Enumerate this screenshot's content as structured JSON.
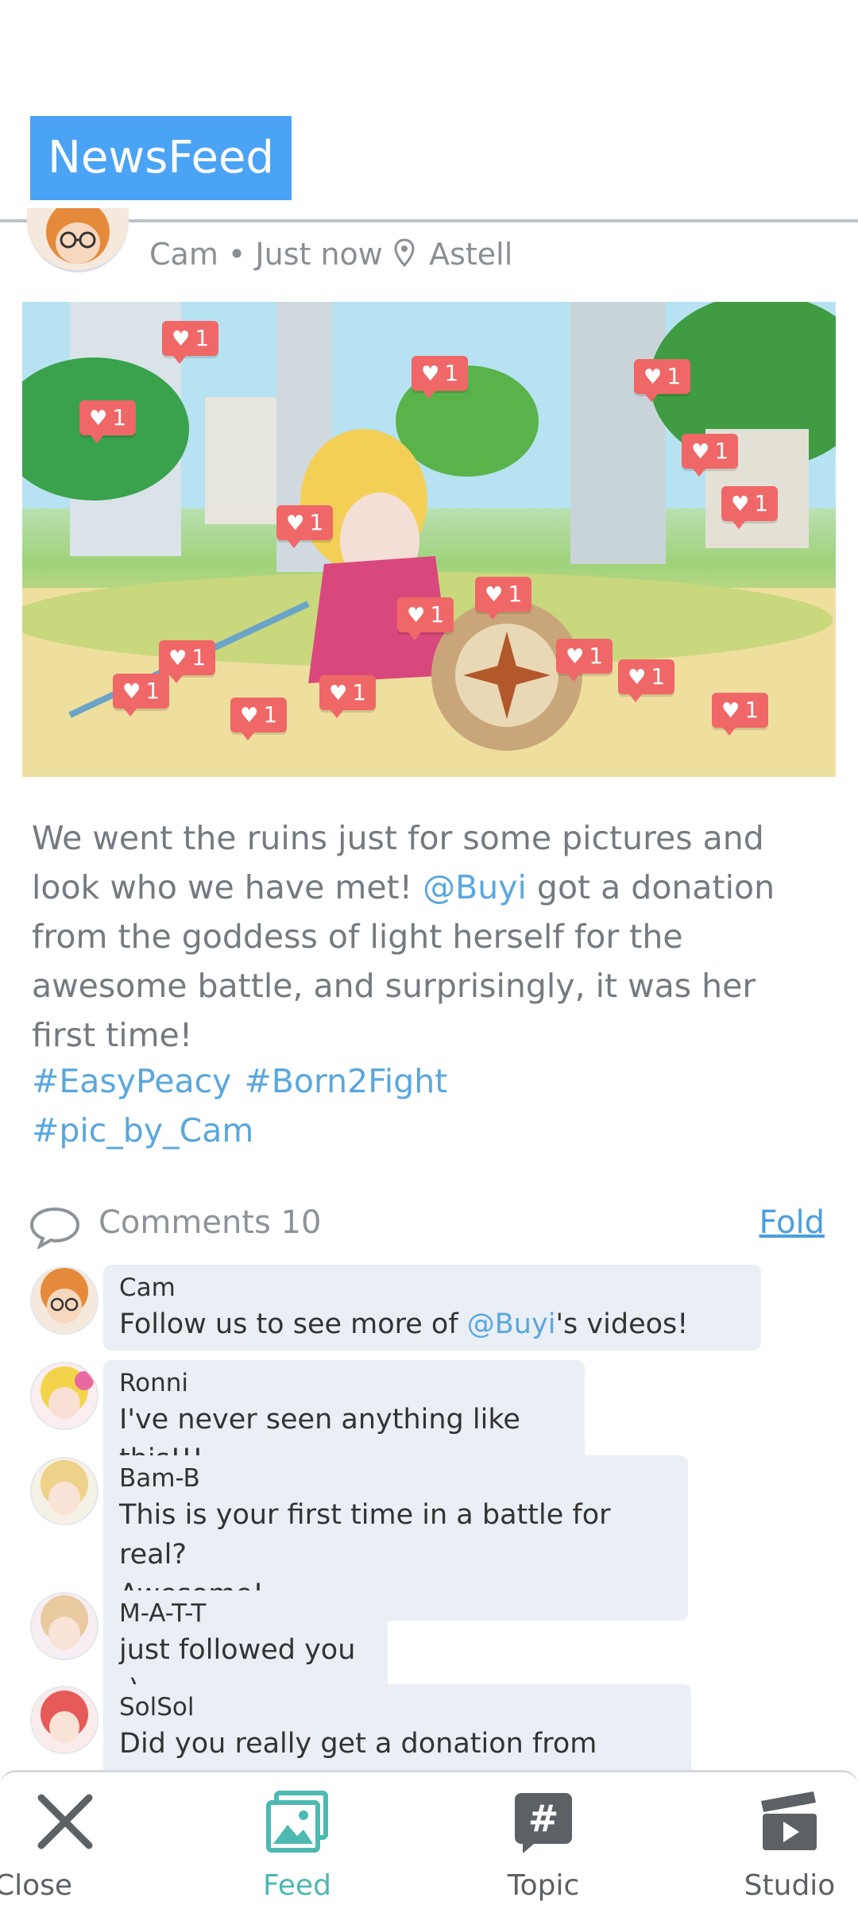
{
  "header": {
    "tab_label": "NewsFeed"
  },
  "post": {
    "author": "Cam",
    "meta_text": "Cam • Just now",
    "location": "Astell",
    "likes_per_tag": "1",
    "body": {
      "before_mention": "We went the ruins just for some pictures and look who we have met! ",
      "mention": "@Buyi",
      "after_mention": " got a donation from the goddess of light herself for the awesome battle, and surprisingly, it was her first time!"
    },
    "hashtags": [
      "#EasyPeacy",
      "#Born2Fight",
      "#pic_by_Cam"
    ]
  },
  "comments_section": {
    "label": "Comments 10",
    "fold_label": "Fold",
    "items": [
      {
        "name": "Cam",
        "text_before": "Follow us to see more of ",
        "mention": "@Buyi",
        "text_after": "'s videos!"
      },
      {
        "name": "Ronni",
        "text": "I've never seen anything like this!!!"
      },
      {
        "name": "Bam-B",
        "text_line1": "This is your first time in a battle for real?",
        "text_line2": "Awesome!"
      },
      {
        "name": "M-A-T-T",
        "text": "just followed you :)"
      },
      {
        "name": "SolSol",
        "text": "Did you really get a donation from Freya?"
      }
    ]
  },
  "bottom_nav": [
    {
      "label": "Close",
      "icon": "close-icon"
    },
    {
      "label": "Feed",
      "icon": "image-gallery-icon",
      "active": true
    },
    {
      "label": "Topic",
      "icon": "hashtag-icon"
    },
    {
      "label": "Studio",
      "icon": "clapperboard-icon"
    }
  ],
  "colors": {
    "accent_blue": "#4aa3f5",
    "mention_blue": "#5aa7dd",
    "active_teal": "#4cb9b2",
    "like_red": "#f06767"
  }
}
